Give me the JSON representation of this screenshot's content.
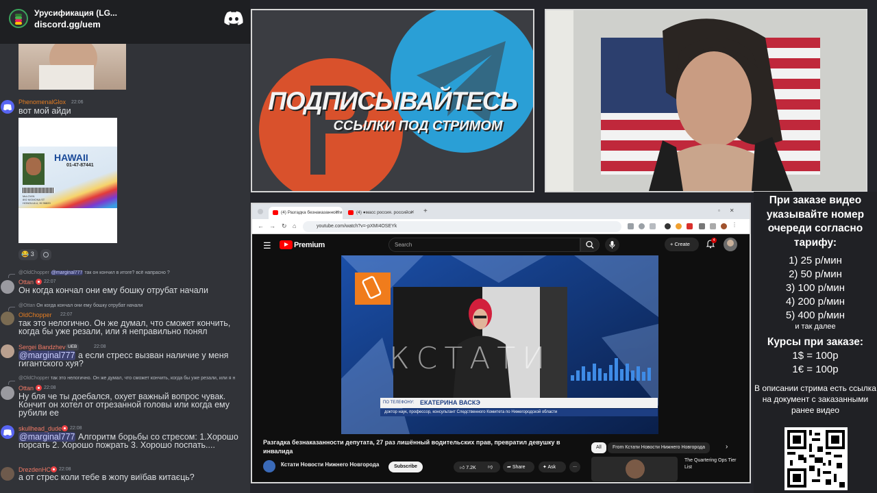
{
  "server": {
    "name": "Урусификация (LG...",
    "invite": "discord.gg/uem"
  },
  "chat": {
    "messages": [
      {
        "user": "PhenomenalGlox",
        "time": "22:06",
        "text": "вот мой айди",
        "user_color": "#e67e22"
      },
      {
        "reactions": [
          {
            "emoji": "😂",
            "count": "3"
          }
        ]
      },
      {
        "reply_user": "@OldChopper",
        "reply_mention": "@marginal777",
        "reply_text": "так он кончил в итоге? всё напрасно ?",
        "user": "Ottan",
        "time": "22:07",
        "text": "Он когда кончал они ему бошку отрубат начали",
        "user_color": "#f47b67"
      },
      {
        "reply_user": "@Ottan",
        "reply_text": "Он когда кончал они ему бошку отрубат начали",
        "user": "OldChopper",
        "time": "22:07",
        "text": "так это нелогично. Он же думал, что сможет кончить, когда бы уже резали, или я неправильно понял",
        "user_color": "#e67e22"
      },
      {
        "user": "Sergei Bandzhev",
        "tag": "UEB",
        "time": "22:08",
        "mention": "@marginal777",
        "text": " а если стресс вызван наличие у меня гигантского хуя?",
        "user_color": "#f47b67"
      },
      {
        "reply_user": "@OldChopper",
        "reply_text": "так это нелогично. Он же думал, что сможет кончить, когда бы уже резали, или я н",
        "user": "Ottan",
        "time": "22:08",
        "text": "Ну бля че ты доебался, охует важный вопрос чувак. Кончит он хотел от отрезанной головы или когда ему рубили ее",
        "user_color": "#f47b67"
      },
      {
        "user": "skullhead_dude",
        "time": "22:08",
        "mention": "@marginal777",
        "text": "  Алгоритм борьбы со стресом: 1.Хорошо порсать 2. Хорошо пожрать 3. Хорошо поспать....",
        "user_color": "#f47b67"
      },
      {
        "user": "DrezdenHC",
        "time": "22:08",
        "text": "а от стрес коли тебе в жопу виїбав китаєць?",
        "user_color": "#f47b67"
      }
    ]
  },
  "promo": {
    "title": "ПОДПИСЫВАЙТЕСЬ",
    "subtitle": "ССЫЛКИ ПОД СТРИМОМ"
  },
  "browser": {
    "tabs": [
      {
        "title": "(4) Разгадка безнаказанности"
      },
      {
        "title": "(4) ●масс россия. российск"
      }
    ],
    "new_tab": "+",
    "url": "youtube.com/watch?v=-pXMI4OSEYk"
  },
  "youtube": {
    "brand": "Premium",
    "search_placeholder": "Search",
    "create_label": "Create",
    "notifications": "4",
    "video": {
      "lower_third_label": "ПО ТЕЛЕФОНУ:",
      "lower_third_name": "ЕКАТЕРИНА ВАСКЭ",
      "lower_third_sub": "доктор наук, профессор, консультант Следственного Комитета по Нижегородской области",
      "watermark": "КСТАТИ"
    },
    "title": "Разгадка безнаказанности депутата, 27 раз лишённый водительских прав, превратил девушку в инвалида",
    "channel": "Кстати Новости Нижнего Новгорода",
    "subscribe": "Subscribe",
    "likes": "7.2K",
    "share": "Share",
    "ask": "Ask",
    "more": "...",
    "chips": [
      {
        "label": "All"
      },
      {
        "label": "From Кстати Новости Нижнего Новгорода"
      }
    ],
    "next_video": "The Quartering Ops Tier List"
  },
  "info": {
    "heading": "При заказе видео указывайте номер очереди согласно тарифу:",
    "tariffs": [
      "1) 25 р/мин",
      "2) 50 р/мин",
      "3) 100 р/мин",
      "4) 200 р/мин",
      "5) 400 р/мин"
    ],
    "etc": "и так далее",
    "rates_heading": "Курсы при заказе:",
    "rates": [
      "1$ = 100р",
      "1€ = 100р"
    ],
    "note": "В описании стрима есть ссылка на документ с заказанными ранее видео"
  },
  "colors": {
    "discord_bg": "#313338",
    "youtube_red": "#ff0000",
    "telegram_blue": "#2a9fd6",
    "rutube_orange": "#d9512c"
  }
}
